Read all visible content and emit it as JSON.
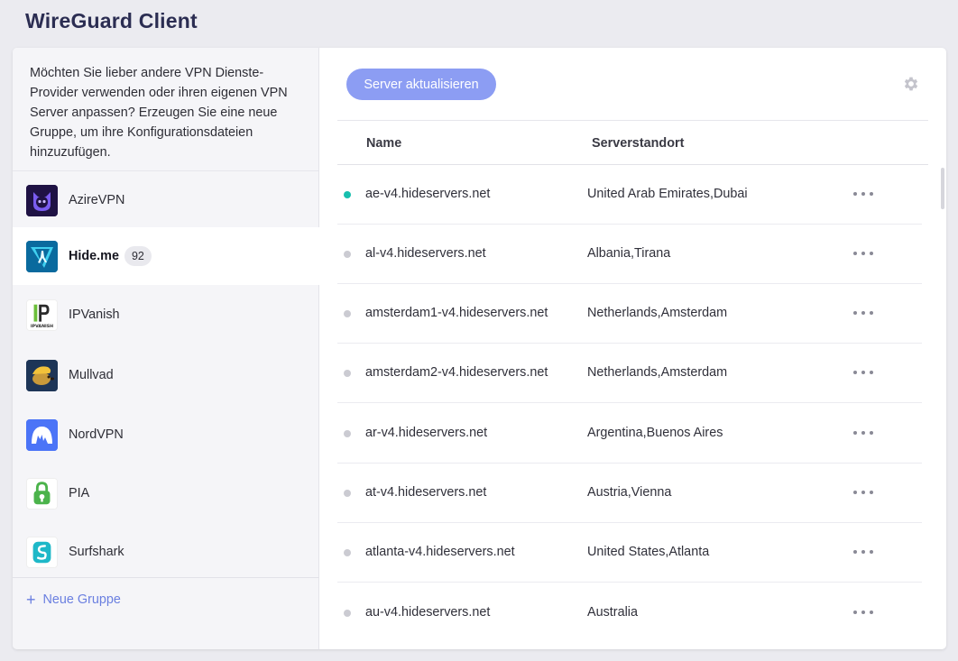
{
  "app": {
    "title": "WireGuard Client"
  },
  "sidebar": {
    "hint": "Möchten Sie lieber andere VPN Dienste-Provider verwenden oder ihren eigenen VPN Server anpassen? Erzeugen Sie eine neue Gruppe, um ihre Konfigurationsdateien hinzuzufügen.",
    "providers": [
      {
        "name": "AzireVPN",
        "icon": "azirevpn-logo-icon"
      },
      {
        "name": "Hide.me",
        "count": "92",
        "active": true,
        "icon": "hideme-logo-icon"
      },
      {
        "name": "IPVanish",
        "icon": "ipvanish-logo-icon",
        "logo_text": "IPVANISH"
      },
      {
        "name": "Mullvad",
        "icon": "mullvad-logo-icon"
      },
      {
        "name": "NordVPN",
        "icon": "nordvpn-logo-icon"
      },
      {
        "name": "PIA",
        "icon": "pia-logo-icon"
      },
      {
        "name": "Surfshark",
        "icon": "surfshark-logo-icon"
      }
    ],
    "new_group_label": "Neue Gruppe"
  },
  "main": {
    "refresh_label": "Server aktualisieren",
    "settings_icon": "gear-icon",
    "columns": {
      "name": "Name",
      "location": "Serverstandort"
    },
    "rows": [
      {
        "name": "ae-v4.hideservers.net",
        "location": "United Arab Emirates,Dubai",
        "status": "online"
      },
      {
        "name": "al-v4.hideservers.net",
        "location": "Albania,Tirana",
        "status": "offline"
      },
      {
        "name": "amsterdam1-v4.hideservers.net",
        "location": "Netherlands,Amsterdam",
        "status": "offline"
      },
      {
        "name": "amsterdam2-v4.hideservers.net",
        "location": "Netherlands,Amsterdam",
        "status": "offline"
      },
      {
        "name": "ar-v4.hideservers.net",
        "location": "Argentina,Buenos Aires",
        "status": "offline"
      },
      {
        "name": "at-v4.hideservers.net",
        "location": "Austria,Vienna",
        "status": "offline"
      },
      {
        "name": "atlanta-v4.hideservers.net",
        "location": "United States,Atlanta",
        "status": "offline"
      },
      {
        "name": "au-v4.hideservers.net",
        "location": "Australia",
        "status": "offline"
      }
    ]
  },
  "colors": {
    "accent": "#8c9df3",
    "link": "#6a7fe0",
    "online": "#17bfae",
    "offline": "#cbcbd2"
  }
}
